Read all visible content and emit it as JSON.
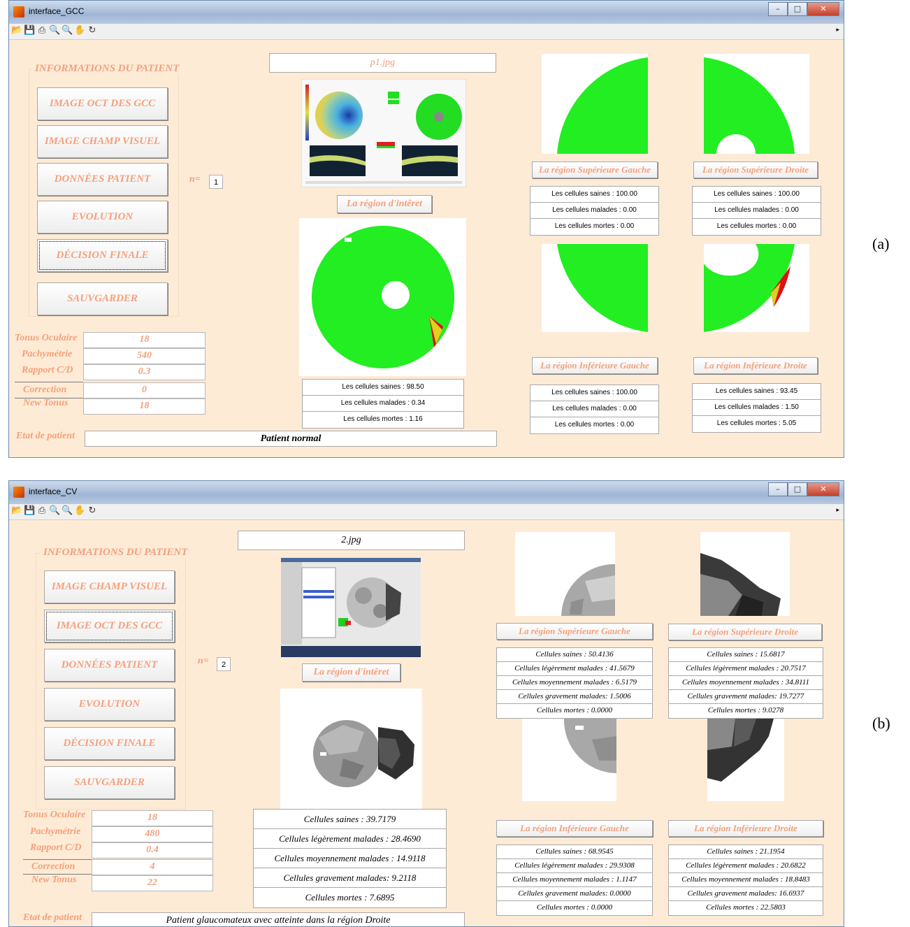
{
  "figure_labels": {
    "a": "(a)",
    "b": "(b)"
  },
  "windows": [
    {
      "title": "interface_GCC",
      "panel_title": "INFORMATIONS DU PATIENT",
      "buttons": [
        "IMAGE OCT DES GCC",
        "IMAGE CHAMP VISUEL",
        "DONNÉES PATIENT",
        "EVOLUTION",
        "DÉCISION FINALE",
        "SAUVGARDER"
      ],
      "n_label": "n=",
      "n_value": "1",
      "filename": "p1.jpg",
      "roi_label": "La région d'intêret",
      "measures": [
        {
          "label": "Tonus Oculaire",
          "value": "18"
        },
        {
          "label": "Pachymétrie",
          "value": "540"
        },
        {
          "label": "Rapport C/D",
          "value": "0.3"
        },
        {
          "label": "Correction",
          "value": "0"
        },
        {
          "label": "New Tonus",
          "value": "18"
        }
      ],
      "main_stats": [
        "Les cellules saines : 98.50",
        "Les cellules malades : 0.34",
        "Les cellules mortes : 1.16"
      ],
      "etat_label": "Etat de patient",
      "etat_value": "Patient normal",
      "regions": [
        {
          "title": "La région  Supérieure Gauche",
          "stats": [
            "Les cellules saines : 100.00",
            "Les cellules malades : 0.00",
            "Les cellules mortes : 0.00"
          ]
        },
        {
          "title": "La région  Supérieure Droite",
          "stats": [
            "Les cellules saines : 100.00",
            "Les cellules malades : 0.00",
            "Les cellules mortes : 0.00"
          ]
        },
        {
          "title": "La région  Inférieure Gauche",
          "stats": [
            "Les cellules saines : 100.00",
            "Les cellules malades : 0.00",
            "Les cellules mortes : 0.00"
          ]
        },
        {
          "title": "La région Inférieure Droite",
          "stats": [
            "Les cellules saines : 93.45",
            "Les cellules malades : 1.50",
            "Les cellules mortes : 5.05"
          ]
        }
      ]
    },
    {
      "title": "interface_CV",
      "panel_title": "INFORMATIONS DU PATIENT",
      "buttons": [
        "IMAGE CHAMP VISUEL",
        "IMAGE OCT DES GCC",
        "DONNÉES PATIENT",
        "EVOLUTION",
        "DÉCISION FINALE",
        "SAUVGARDER"
      ],
      "n_label": "n=",
      "n_value": "2",
      "filename": "2.jpg",
      "roi_label": "La région d'intêret",
      "measures": [
        {
          "label": "Tonus Oculaire",
          "value": "18"
        },
        {
          "label": "Pachymétrie",
          "value": "480"
        },
        {
          "label": "Rapport C/D",
          "value": "0.4"
        },
        {
          "label": "Correction",
          "value": "4"
        },
        {
          "label": "New Tonus",
          "value": "22"
        }
      ],
      "main_stats": [
        "Cellules saines : 39.7179",
        "Cellules légèrement malades : 28.4690",
        "Cellules moyennement malades : 14.9118",
        "Cellules gravement malades: 9.2118",
        "Cellules mortes : 7.6895"
      ],
      "etat_label": "Etat de patient",
      "etat_value": "Patient glaucomateux avec atteinte dans la région Droite",
      "regions": [
        {
          "title": "La région Supérieure Gauche",
          "stats": [
            "Cellules saines : 50.4136",
            "Cellules légèrement malades : 41.5679",
            "Cellules moyennement malades : 6.5179",
            "Cellules gravement malades: 1.5006",
            "Cellules mortes : 0.0000"
          ]
        },
        {
          "title": "La région Supérieure Droite",
          "stats": [
            "Cellules saines : 15.6817",
            "Cellules légèrement malades : 20.7517",
            "Cellules moyennement malades : 34.8111",
            "Cellules gravement malades: 19.7277",
            "Cellules mortes : 9.0278"
          ]
        },
        {
          "title": "La région Inférieure Gauche",
          "stats": [
            "Cellules saines : 68.9545",
            "Cellules légèrement malades : 29.9308",
            "Cellules moyennement malades : 1.1147",
            "Cellules gravement malades: 0.0000",
            "Cellules mortes : 0.0000"
          ]
        },
        {
          "title": "La région Inférieure Droite",
          "stats": [
            "Cellules saines : 21.1954",
            "Cellules légèrement malades : 20.6822",
            "Cellules moyennement malades : 18.8483",
            "Cellules gravement malades: 16.6937",
            "Cellules mortes : 22.5803"
          ]
        }
      ]
    }
  ]
}
